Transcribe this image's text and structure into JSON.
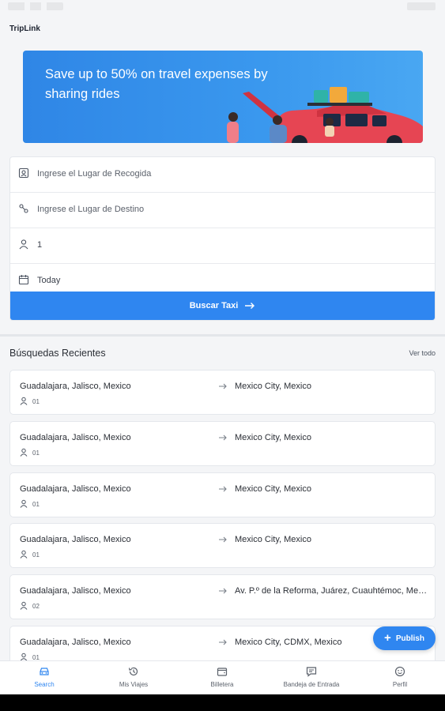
{
  "app": {
    "title": "TripLink"
  },
  "banner": {
    "text": "Save up to 50% on travel expenses by sharing rides"
  },
  "search_form": {
    "pickup_placeholder": "Ingrese el Lugar de Recogida",
    "destination_placeholder": "Ingrese el Lugar de Destino",
    "passengers_value": "1",
    "date_value": "Today",
    "search_button_label": "Buscar Taxi"
  },
  "recent": {
    "title": "Búsquedas Recientes",
    "see_all_label": "Ver todo",
    "items": [
      {
        "from": "Guadalajara, Jalisco, Mexico",
        "to": "Mexico City, Mexico",
        "passengers": "01"
      },
      {
        "from": "Guadalajara, Jalisco, Mexico",
        "to": "Mexico City, Mexico",
        "passengers": "01"
      },
      {
        "from": "Guadalajara, Jalisco, Mexico",
        "to": "Mexico City, Mexico",
        "passengers": "01"
      },
      {
        "from": "Guadalajara, Jalisco, Mexico",
        "to": "Mexico City, Mexico",
        "passengers": "01"
      },
      {
        "from": "Guadalajara, Jalisco, Mexico",
        "to": "Av. P.º de la Reforma, Juárez, Cuauhtémoc, Mexico City",
        "passengers": "02"
      },
      {
        "from": "Guadalajara, Jalisco, Mexico",
        "to": "Mexico City, CDMX, Mexico",
        "passengers": "01"
      }
    ]
  },
  "publish_button": {
    "label": "Publish"
  },
  "bottom_nav": {
    "items": [
      {
        "label": "Search",
        "icon": "car-icon",
        "active": true
      },
      {
        "label": "Mis Viajes",
        "icon": "history-icon",
        "active": false
      },
      {
        "label": "Billetera",
        "icon": "wallet-icon",
        "active": false
      },
      {
        "label": "Bandeja de Entrada",
        "icon": "chat-icon",
        "active": false
      },
      {
        "label": "Perfil",
        "icon": "smile-icon",
        "active": false
      }
    ]
  },
  "colors": {
    "accent": "#2f86f0",
    "background": "#f4f5f7",
    "card": "#ffffff"
  }
}
